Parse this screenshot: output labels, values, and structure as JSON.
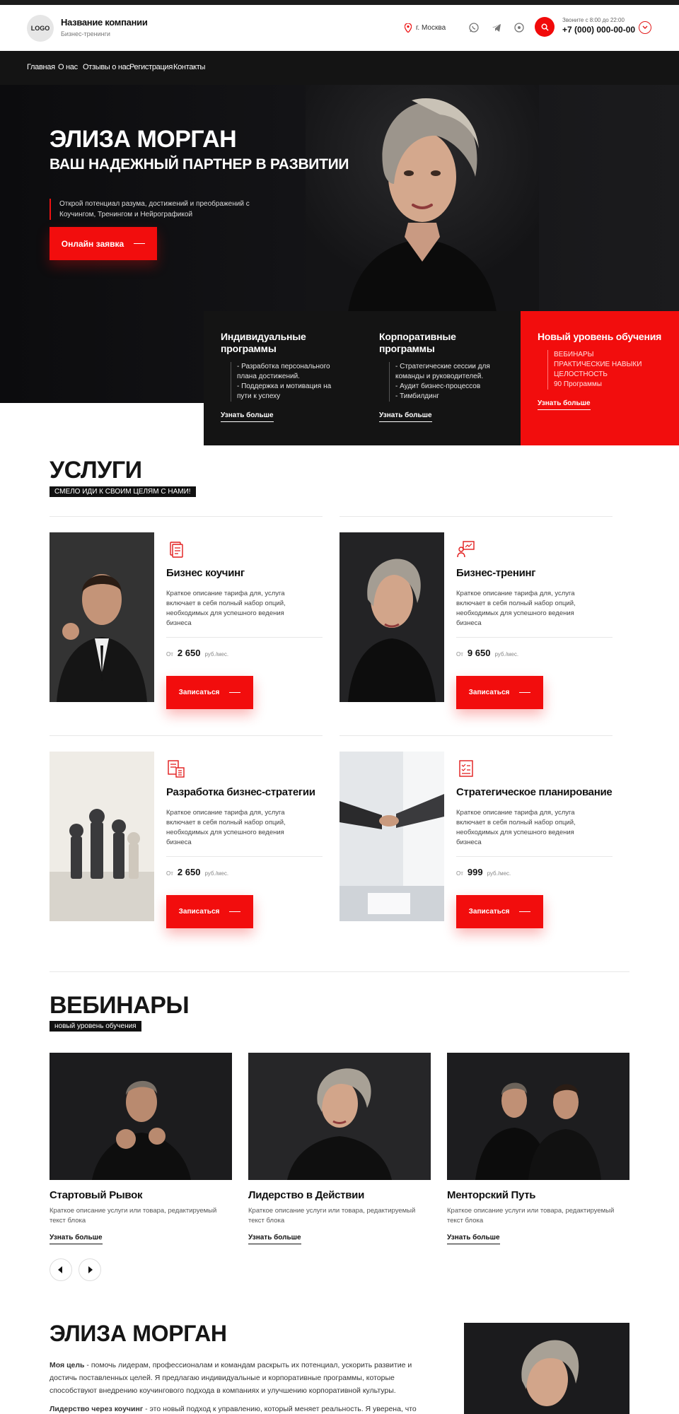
{
  "header": {
    "logo": "LOGO",
    "company_name": "Название компании",
    "tagline": "Бизнес-тренинги",
    "city": "г. Москва",
    "call_note": "Звоните с 8:00 до 22:00",
    "phone": "+7 (000) 000-00-00"
  },
  "nav": [
    "Главная",
    "О нас",
    "Отзывы о нас",
    "Регистрация",
    "Контакты"
  ],
  "hero": {
    "title": "ЭЛИЗА МОРГАН",
    "subtitle": "ВАШ НАДЕЖНЫЙ ПАРТНЕР В РАЗВИТИИ",
    "text": "Открой потенциал разума, достижений и преображений с Коучингом, Тренингом и Нейрографикой",
    "button": "Онлайн заявка"
  },
  "programs": [
    {
      "title": "Индивидуальные программы",
      "items": [
        "- Разработка персонального плана достижений.",
        "- Поддержка и мотивация на пути к успеху"
      ],
      "more": "Узнать больше"
    },
    {
      "title": "Корпоративные программы",
      "items": [
        "- Стратегические сессии для команды и руководителей.",
        "- Аудит бизнес-процессов",
        "- Тимбилдинг"
      ],
      "more": "Узнать больше"
    },
    {
      "title": "Новый уровень обучения",
      "items": [
        "ВЕБИНАРЫ",
        "ПРАКТИЧЕСКИЕ НАВЫКИ",
        "ЦЕЛОСТНОСТЬ",
        "90 Программы"
      ],
      "more": "Узнать больше"
    }
  ],
  "services": {
    "title": "УСЛУГИ",
    "tag": "СМЕЛО ИДИ К СВОИМ ЦЕЛЯМ С НАМИ!",
    "items": [
      {
        "title": "Бизнес коучинг",
        "desc": "Краткое описание тарифа для, услуга включает в себя полный набор опций, необходимых для успешного ведения бизнеса",
        "from": "От",
        "price": "2 650",
        "unit": "руб./мес.",
        "button": "Записаться",
        "icon": "document-stack-icon"
      },
      {
        "title": "Бизнес-тренинг",
        "desc": "Краткое описание тарифа для, услуга включает в себя полный набор опций, необходимых для успешного ведения бизнеса",
        "from": "От",
        "price": "9 650",
        "unit": "руб./мес.",
        "button": "Записаться",
        "icon": "presentation-icon"
      },
      {
        "title": "Разработка бизнес-стратегии",
        "desc": "Краткое описание тарифа для, услуга включает в себя полный набор опций, необходимых для успешного ведения бизнеса",
        "from": "От",
        "price": "2 650",
        "unit": "руб./мес.",
        "button": "Записаться",
        "icon": "documents-calculator-icon"
      },
      {
        "title": "Стратегическое планирование",
        "desc": "Краткое описание тарифа для, услуга включает в себя полный набор опций, необходимых для успешного ведения бизнеса",
        "from": "От",
        "price": "999",
        "unit": "руб./мес.",
        "button": "Записаться",
        "icon": "checklist-icon"
      }
    ]
  },
  "webinars": {
    "title": "ВЕБИНАРЫ",
    "tag": "новый уровень обучения",
    "items": [
      {
        "title": "Стартовый Рывок",
        "desc": "Краткое описание услуги или товара, редактируемый текст блока",
        "more": "Узнать больше"
      },
      {
        "title": "Лидерство в Действии",
        "desc": "Краткое описание услуги или товара, редактируемый текст блока",
        "more": "Узнать больше"
      },
      {
        "title": "Менторский Путь",
        "desc": "Краткое описание услуги или товара, редактируемый текст блока",
        "more": "Узнать больше"
      }
    ]
  },
  "about": {
    "title": "ЭЛИЗА МОРГАН",
    "p1_strong": "Моя цель",
    "p1": " - помочь лидерам, профессионалам и командам раскрыть их потенциал, ускорить развитие и достичь поставленных целей. Я предлагаю индивидуальные и корпоративные программы, которые способствуют внедрению коучингового подхода в компаниях и улучшению корпоративной культуры.",
    "p2_strong": "Лидерство через коучинг",
    "p2": " - это новый подход к управлению, который меняет реальность. Я уверена, что"
  },
  "colors": {
    "accent": "#f20d0d",
    "dark": "#141414"
  }
}
